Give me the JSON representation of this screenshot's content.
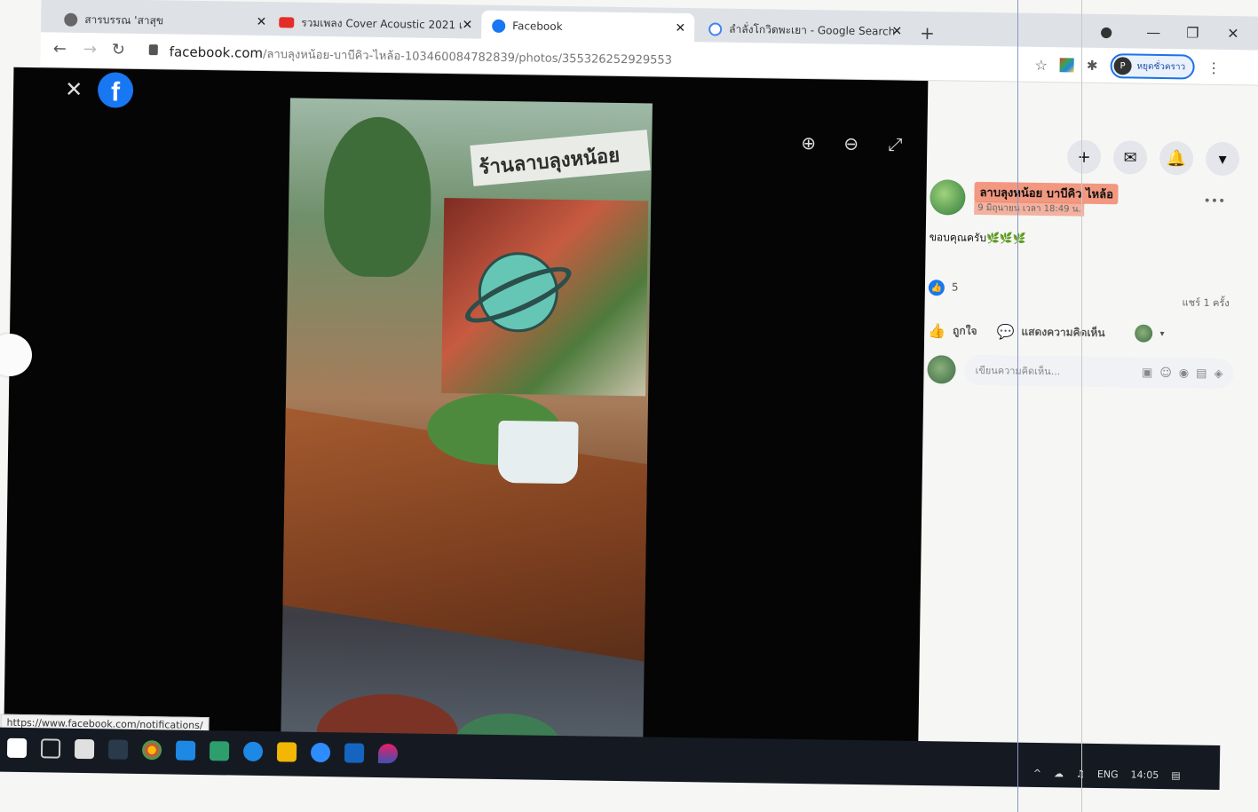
{
  "tabs": [
    {
      "title": "สารบรรณ 'สาสุข",
      "close": "✕"
    },
    {
      "title": "รวมเพลง Cover Acoustic 2021 เ",
      "close": "✕"
    },
    {
      "title": "Facebook",
      "close": "✕"
    },
    {
      "title": "ลำลั่งโกวิดพะเยา - Google Search",
      "close": "✕"
    }
  ],
  "browser": {
    "new_tab": "+",
    "profile_dot": "●",
    "minimize": "—",
    "restore": "❐",
    "close": "✕",
    "back": "←",
    "forward": "→",
    "reload": "↻",
    "url_domain": "facebook.com",
    "url_path": "/ลาบลุงหน้อย-บาบีคิว-ไหล้อ-103460084782839/photos/355326252929553",
    "star": "☆",
    "puzzle": "✱",
    "profile_initial": "P",
    "profile_label": "หยุดชั่วคราว",
    "menu": "⋮"
  },
  "viewer": {
    "close": "✕",
    "logo": "f",
    "sign_text": "ร้านลาบลุงหน้อย",
    "zoom_in": "⊕",
    "zoom_out": "⊖",
    "fullscreen": "⤢"
  },
  "fb_header": {
    "create": "+",
    "messenger": "✉",
    "notifications": "🔔",
    "account": "▾"
  },
  "post": {
    "page_name": "ลาบลุงหน้อย บาบีคิว ไหล้อ",
    "date": "9 มิถุนายน เวลา 18:49 น.",
    "more": "•••",
    "caption": "ขอบคุณครับ🌿🌿🌿",
    "like_glyph": "👍",
    "reactions": "5",
    "shares": "แชร์ 1 ครั้ง",
    "like_icon": "👍",
    "like_label": "ถูกใจ",
    "comment_icon": "💬",
    "comment_label": "แสดงความคิดเห็น",
    "chevron": "▾",
    "comment_placeholder": "เขียนความคิดเห็น...",
    "tool_1": "▣",
    "tool_2": "☺",
    "tool_3": "◉",
    "tool_4": "▤",
    "tool_5": "◈"
  },
  "status_url": "https://www.facebook.com/notifications/",
  "taskbar": {
    "tray_chevron": "^",
    "network": "☁",
    "volume": "♫",
    "language": "ENG",
    "time": "14:05",
    "notification": "▤"
  }
}
